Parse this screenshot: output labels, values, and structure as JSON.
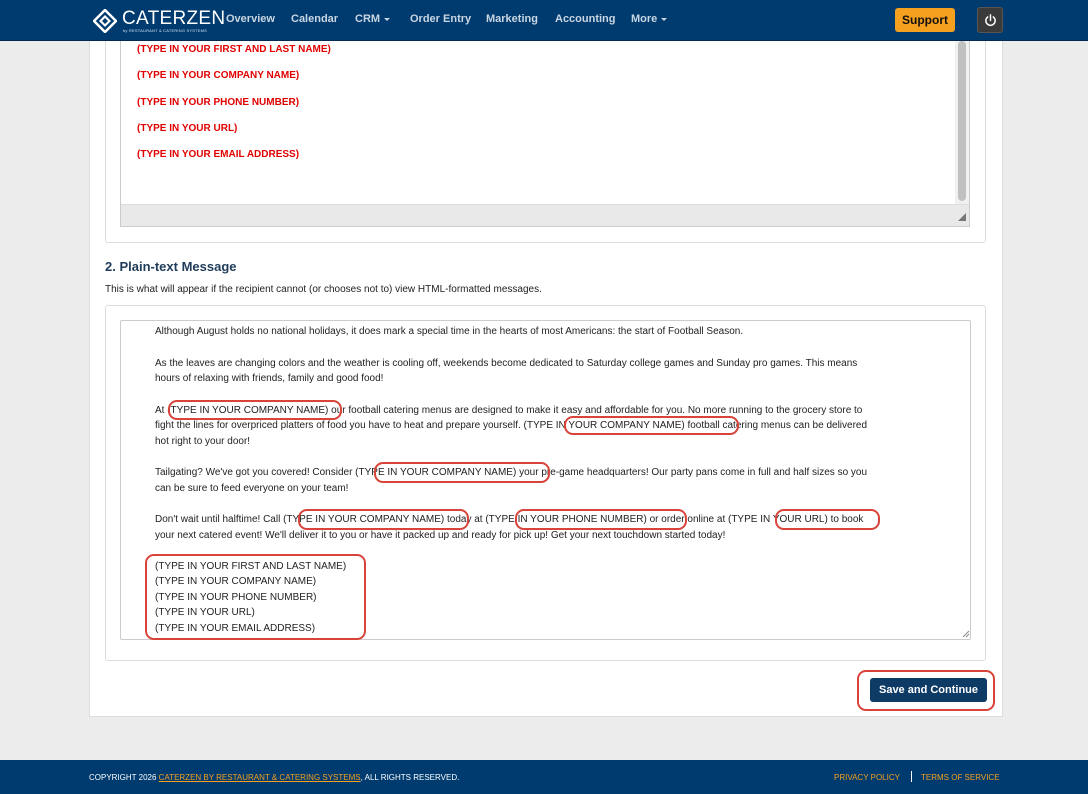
{
  "brand": {
    "name": "CATERZEN",
    "tagline": "by RESTAURANT & CATERING SYSTEMS"
  },
  "nav": {
    "items": [
      "Overview",
      "Calendar",
      "CRM",
      "Order Entry",
      "Marketing",
      "Accounting",
      "More"
    ],
    "support_label": "Support"
  },
  "html_message": {
    "lines": [
      "(TYPE IN YOUR FIRST AND LAST NAME)",
      "(TYPE IN YOUR COMPANY NAME)",
      "(TYPE IN YOUR PHONE NUMBER)",
      "(TYPE IN YOUR URL)",
      "(TYPE IN YOUR EMAIL ADDRESS)"
    ]
  },
  "plain_text": {
    "title": "2. Plain-text Message",
    "description": "This is what will appear if the recipient cannot (or chooses not to) view HTML-formatted messages.",
    "lines": [
      "Although August holds no national holidays, it does mark a special time in the hearts of most Americans: the start of Football Season.",
      "As the leaves are changing colors and the weather is cooling off, weekends become dedicated to Saturday college games and Sunday pro games. This means",
      "hours of relaxing with friends, family and good food!",
      "At (TYPE IN YOUR COMPANY NAME) our football catering menus are designed to make it easy and affordable for you. No more running to the grocery store to",
      "fight the lines for overpriced platters of food you have to heat and prepare yourself. (TYPE IN YOUR COMPANY NAME) football catering menus can be delivered",
      "hot right to your door!",
      "Tailgating? We've got you covered! Consider (TYPE IN YOUR COMPANY NAME) your pre-game headquarters! Our party pans come in full and half sizes so you",
      "can be sure to feed everyone on your team!",
      "Don't wait until halftime! Call (TYPE IN YOUR COMPANY NAME) today at (TYPE IN YOUR PHONE NUMBER) or order online at (TYPE IN YOUR URL) to book",
      "your next catered event! We'll deliver it to you or have it packed up and ready for pick up!  Get your next touchdown started today!",
      "(TYPE IN YOUR FIRST AND LAST NAME)",
      "(TYPE IN YOUR COMPANY NAME)",
      "(TYPE IN YOUR PHONE NUMBER)",
      "(TYPE IN YOUR URL)",
      "(TYPE IN YOUR EMAIL ADDRESS)"
    ]
  },
  "actions": {
    "save_label": "Save and Continue"
  },
  "footer": {
    "copyright_prefix": "COPYRIGHT 2026 ",
    "company_link": "CATERZEN BY RESTAURANT & CATERING SYSTEMS",
    "rights": ", ALL RIGHTS RESERVED.",
    "privacy": "PRIVACY POLICY",
    "terms": "TERMS OF SERVICE"
  },
  "colors": {
    "nav_bg": "#003b6f",
    "accent": "#f5a01e",
    "placeholder_red": "#e00000",
    "highlight": "#d9443a",
    "button": "#0e3a66"
  },
  "icons": [
    "caterzen-logo-icon",
    "caret-down-icon",
    "power-icon",
    "resize-grip-icon"
  ]
}
